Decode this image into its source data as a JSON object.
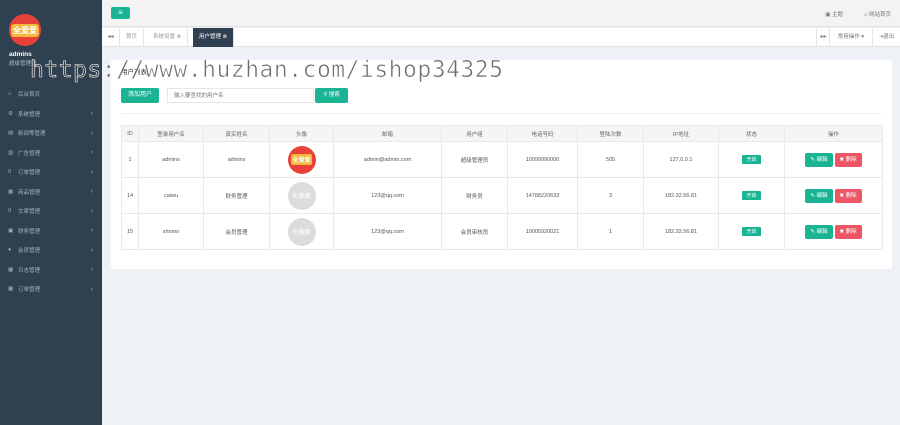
{
  "sidebar": {
    "logo_text": "全爱爱",
    "user_name": "admins",
    "user_role": "超级管理员",
    "items": [
      {
        "icon": "home-icon",
        "glyph": "⌂",
        "label": "后台首页",
        "has_children": false
      },
      {
        "icon": "gear-icon",
        "glyph": "⚙",
        "label": "系统管理",
        "has_children": true
      },
      {
        "icon": "document-icon",
        "glyph": "▤",
        "label": "新闻等管理",
        "has_children": true
      },
      {
        "icon": "chart-icon",
        "glyph": "▥",
        "label": "广告管理",
        "has_children": true
      },
      {
        "icon": "door-icon",
        "glyph": "⌷",
        "label": "订单管理",
        "has_children": true
      },
      {
        "icon": "grid-icon",
        "glyph": "▦",
        "label": "商品管理",
        "has_children": true
      },
      {
        "icon": "door-icon",
        "glyph": "⌷",
        "label": "文章管理",
        "has_children": true
      },
      {
        "icon": "book-icon",
        "glyph": "▣",
        "label": "财务管理",
        "has_children": true
      },
      {
        "icon": "user-icon",
        "glyph": "●",
        "label": "会员管理",
        "has_children": true
      },
      {
        "icon": "grid-icon",
        "glyph": "▦",
        "label": "日志管理",
        "has_children": true
      },
      {
        "icon": "grid-icon",
        "glyph": "▦",
        "label": "订单管理",
        "has_children": true
      }
    ]
  },
  "topbar": {
    "menu_glyph": "≡",
    "theme_label": "▣ 主题",
    "home_label": "⌂ 网站首页"
  },
  "tabs": {
    "prev_glyph": "◂◂",
    "next_glyph": "▸▸",
    "items": [
      {
        "label": "首页",
        "active": false
      },
      {
        "label": "系统设置 ⊗",
        "active": false
      },
      {
        "label": "用户管理 ⊗",
        "active": true
      }
    ],
    "operations_label": "常用操作 ▾",
    "close_label": "⇥退出"
  },
  "panel": {
    "title": "用户列表",
    "add_button": "添加用户",
    "search_placeholder": "输入要查找的用户名",
    "search_button": "⚲ 搜索"
  },
  "table": {
    "headers": [
      "ID",
      "登录用户名",
      "真实姓名",
      "头像",
      "邮箱",
      "用户组",
      "电话号码",
      "登陆次数",
      "IP地址",
      "状态",
      "操作"
    ],
    "rows": [
      {
        "id": "1",
        "login": "admins",
        "realname": "admins",
        "avatar": "brand",
        "avatar_text": "全爱爱",
        "email": "admin@admin.com",
        "group": "超级管理员",
        "phone": "10099990000",
        "logins": "505",
        "ip": "127.0.0.1",
        "status": "开启",
        "edit": "✎ 编辑",
        "delete": "✖ 删除"
      },
      {
        "id": "14",
        "login": "caiwu",
        "realname": "财务管理",
        "avatar": "grey",
        "avatar_text": "头像图",
        "email": "123@qq.com",
        "group": "财务员",
        "phone": "14788220633",
        "logins": "3",
        "ip": "182.32.56.81",
        "status": "开启",
        "edit": "✎ 编辑",
        "delete": "✖ 删除"
      },
      {
        "id": "15",
        "login": "shomo",
        "realname": "会员管理",
        "avatar": "grey",
        "avatar_text": "头像图",
        "email": "123@qq.com",
        "group": "会员审核员",
        "phone": "10005920021",
        "logins": "1",
        "ip": "182.32.56.81",
        "status": "开启",
        "edit": "✎ 编辑",
        "delete": "✖ 删除"
      }
    ]
  },
  "watermark": "https://www.huzhan.com/ishop34325"
}
